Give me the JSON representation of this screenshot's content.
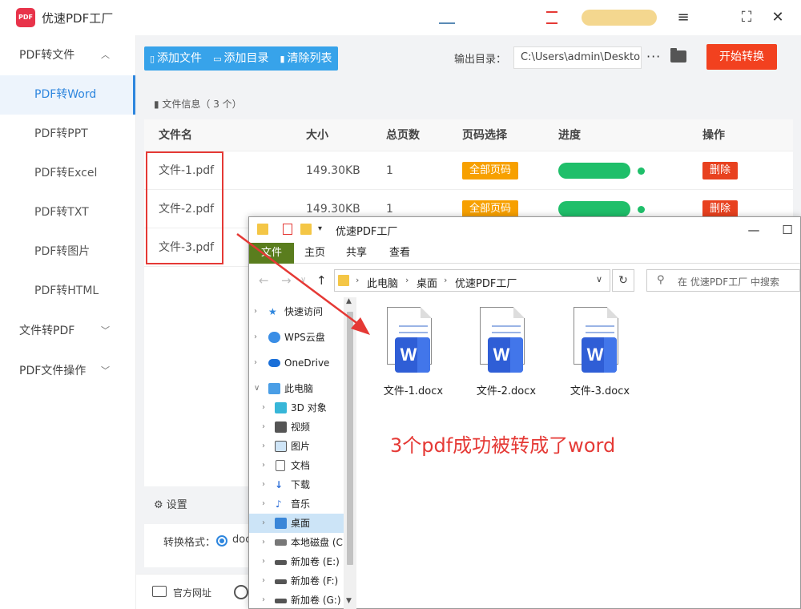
{
  "app": {
    "title": "优速PDF工厂",
    "logo_text": "PDF",
    "accent": "#2e86de"
  },
  "window_controls": [
    "menu-icon",
    "maximize-icon",
    "close-icon"
  ],
  "sidebar": {
    "groups": [
      {
        "label": "PDF转文件",
        "expanded": true
      },
      {
        "label": "文件转PDF",
        "expanded": false
      },
      {
        "label": "PDF文件操作",
        "expanded": false
      }
    ],
    "items": [
      {
        "label": "PDF转Word",
        "active": true
      },
      {
        "label": "PDF转PPT"
      },
      {
        "label": "PDF转Excel"
      },
      {
        "label": "PDF转TXT"
      },
      {
        "label": "PDF转图片"
      },
      {
        "label": "PDF转HTML"
      }
    ]
  },
  "toolbar": {
    "add_file": "添加文件",
    "add_dir": "添加目录",
    "clear_list": "清除列表",
    "output_label": "输出目录：",
    "output_path": "C:\\Users\\admin\\Deskto",
    "more": "···",
    "start": "开始转换"
  },
  "file_table": {
    "info": "文件信息（ 3 个）",
    "columns": [
      "文件名",
      "大小",
      "总页数",
      "页码选择",
      "进度",
      "操作"
    ],
    "rows": [
      {
        "name": "文件-1.pdf",
        "size": "149.30KB",
        "pages": "1",
        "page_select": "全部页码",
        "action": "删除"
      },
      {
        "name": "文件-2.pdf",
        "size": "149.30KB",
        "pages": "1",
        "page_select": "全部页码",
        "action": "删除"
      },
      {
        "name": "文件-3.pdf"
      }
    ]
  },
  "settings": {
    "title": "设置",
    "format_label": "转换格式：",
    "format_value": "doc"
  },
  "footer": {
    "website": "官方网址"
  },
  "explorer": {
    "title": "优速PDF工厂",
    "ribbon_tabs": [
      "文件",
      "主页",
      "共享",
      "查看"
    ],
    "address": [
      "此电脑",
      "桌面",
      "优速PDF工厂"
    ],
    "search_placeholder": "在 优速PDF工厂 中搜索",
    "tree": [
      {
        "label": "快速访问",
        "icon": "star-icon"
      },
      {
        "label": "WPS云盘",
        "icon": "cloud-icon"
      },
      {
        "label": "OneDrive",
        "icon": "cloud-icon"
      },
      {
        "label": "此电脑",
        "icon": "computer-icon"
      },
      {
        "label": "3D 对象",
        "icon": "cube-icon"
      },
      {
        "label": "视频",
        "icon": "video-icon"
      },
      {
        "label": "图片",
        "icon": "picture-icon"
      },
      {
        "label": "文档",
        "icon": "document-icon"
      },
      {
        "label": "下载",
        "icon": "download-icon"
      },
      {
        "label": "音乐",
        "icon": "music-icon"
      },
      {
        "label": "桌面",
        "icon": "desktop-icon",
        "selected": true
      },
      {
        "label": "本地磁盘 (C",
        "icon": "drive-icon"
      },
      {
        "label": "新加卷 (E:)",
        "icon": "drive-icon"
      },
      {
        "label": "新加卷 (F:)",
        "icon": "drive-icon"
      },
      {
        "label": "新加卷 (G:)",
        "icon": "drive-icon"
      }
    ],
    "files": [
      {
        "name": "文件-1.docx",
        "badge": "W"
      },
      {
        "name": "文件-2.docx",
        "badge": "W"
      },
      {
        "name": "文件-3.docx",
        "badge": "W"
      }
    ]
  },
  "annotation": "3个pdf成功被转成了word",
  "colors": {
    "primary_blue": "#37a3ea",
    "start_red": "#f2411f",
    "page_orange": "#f7a000",
    "progress_green": "#1fbf6a",
    "annotation_red": "#e53935"
  }
}
